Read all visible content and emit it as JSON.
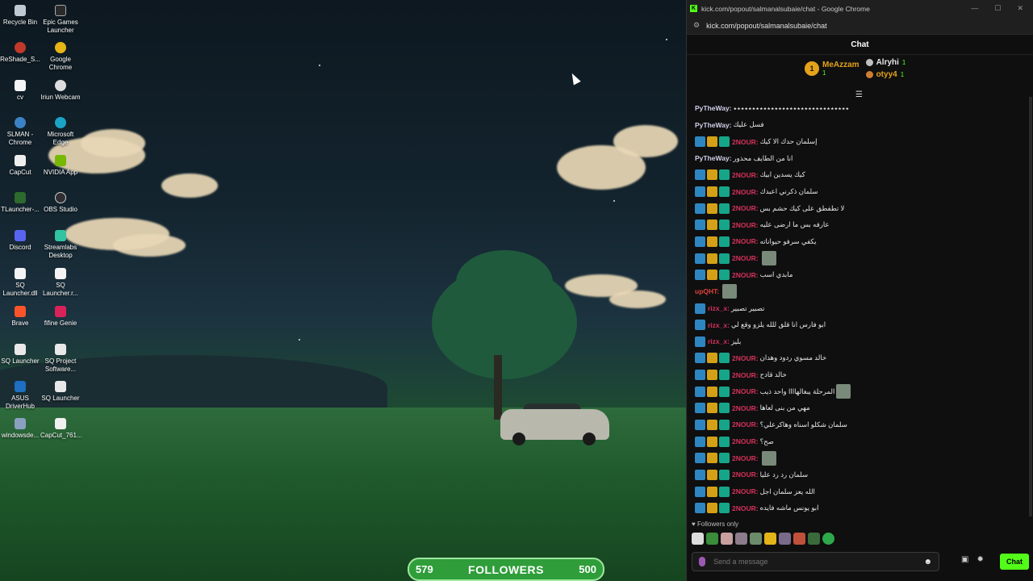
{
  "desktop_icons": [
    {
      "label": "Recycle Bin"
    },
    {
      "label": "Epic Games Launcher"
    },
    {
      "label": "ReShade_S..."
    },
    {
      "label": "Google Chrome"
    },
    {
      "label": "cv"
    },
    {
      "label": "Iriun Webcam"
    },
    {
      "label": "SLMAN - Chrome"
    },
    {
      "label": "Microsoft Edge"
    },
    {
      "label": "CapCut"
    },
    {
      "label": "NVIDIA App"
    },
    {
      "label": "TLauncher-..."
    },
    {
      "label": "OBS Studio"
    },
    {
      "label": "Discord"
    },
    {
      "label": "Streamlabs Desktop"
    },
    {
      "label": "SQ Launcher.dll"
    },
    {
      "label": "SQ Launcher.r..."
    },
    {
      "label": "Brave"
    },
    {
      "label": "fifine Genie"
    },
    {
      "label": "SQ Launcher"
    },
    {
      "label": "SQ Project Software..."
    },
    {
      "label": "ASUS DriverHub"
    },
    {
      "label": "SQ Launcher"
    },
    {
      "label": "windowsde..."
    },
    {
      "label": "CapCut_761..."
    }
  ],
  "followers_bar": {
    "left": "579",
    "label": "FOLLOWERS",
    "right": "500"
  },
  "window": {
    "title": "kick.com/popout/salmanalsubaie/chat - Google Chrome",
    "url": "kick.com/popout/salmanalsubaie/chat",
    "controls": [
      "—",
      "☐",
      "✕"
    ]
  },
  "chat": {
    "header": "Chat",
    "leaderboard": {
      "first": {
        "rank": "1",
        "name": "MeAzzam",
        "count": "1"
      },
      "second": {
        "name": "Alryhi",
        "count": "1"
      },
      "third": {
        "name": "otyy4",
        "count": "1"
      }
    },
    "messages": [
      {
        "user": "PyTheWay:",
        "text": "٭٭٭٭٭٭٭٭٭٭٭٭٭٭٭٭٭٭٭٭٭٭٭٭٭٭٭٭٭٭٭",
        "badges": false,
        "color": "#cfcfe8",
        "emote": false
      },
      {
        "user": "PyTheWay:",
        "text": "فسل عليك",
        "badges": false,
        "color": "#cfcfe8",
        "emote": false
      },
      {
        "user": "2NOUR:",
        "text": "إسلمان حدك الا كيك",
        "badges": true,
        "color": "#d6325a",
        "emote": false
      },
      {
        "user": "PyTheWay:",
        "text": "انا من الطايف محذور",
        "badges": false,
        "color": "#cfcfe8",
        "emote": false
      },
      {
        "user": "2NOUR:",
        "text": "كيك يسدين ابيك",
        "badges": true,
        "color": "#d6325a",
        "emote": false
      },
      {
        "user": "2NOUR:",
        "text": "سلمان ذكرني اعبدك",
        "badges": true,
        "color": "#d6325a",
        "emote": false
      },
      {
        "user": "2NOUR:",
        "text": "لا تطفطق على كيك حشم بس",
        "badges": true,
        "color": "#d6325a",
        "emote": false
      },
      {
        "user": "2NOUR:",
        "text": "عارفه بس ما ارضى عليه",
        "badges": true,
        "color": "#d6325a",
        "emote": false
      },
      {
        "user": "2NOUR:",
        "text": "يكفي سرفو حيواناته",
        "badges": true,
        "color": "#d6325a",
        "emote": false
      },
      {
        "user": "2NOUR:",
        "text": "",
        "badges": true,
        "color": "#d6325a",
        "emote": true
      },
      {
        "user": "2NOUR:",
        "text": "مابدي اسب",
        "badges": true,
        "color": "#d6325a",
        "emote": false
      },
      {
        "user": "upQHT:",
        "text": "",
        "badges": false,
        "color": "#e0433a",
        "emote": true
      },
      {
        "user": "rizx_x:",
        "text": "تصبير تصبير",
        "badges": true,
        "color": "#d6325a",
        "emote": false,
        "single": true
      },
      {
        "user": "rizx_x:",
        "text": "ابو فارس انا قلق للله يلزو وقع لي",
        "badges": true,
        "color": "#d6325a",
        "emote": false,
        "single": true
      },
      {
        "user": "rizx_x:",
        "text": "بليز",
        "badges": true,
        "color": "#d6325a",
        "emote": false,
        "single": true
      },
      {
        "user": "2NOUR:",
        "text": "خالد مسوي ردود وهدان",
        "badges": true,
        "color": "#d6325a",
        "emote": false
      },
      {
        "user": "2NOUR:",
        "text": "خالد قادح",
        "badges": true,
        "color": "#d6325a",
        "emote": false
      },
      {
        "user": "2NOUR:",
        "text": "المرحلة يبغالهاااا واحد ذيب",
        "badges": true,
        "color": "#d6325a",
        "emote": true
      },
      {
        "user": "2NOUR:",
        "text": "مهي من بنى لعاها",
        "badges": true,
        "color": "#d6325a",
        "emote": false
      },
      {
        "user": "2NOUR:",
        "text": "سلمان شكلو اسناه وهاكرعلي؟",
        "badges": true,
        "color": "#d6325a",
        "emote": false
      },
      {
        "user": "2NOUR:",
        "text": "صح؟",
        "badges": true,
        "color": "#d6325a",
        "emote": false
      },
      {
        "user": "2NOUR:",
        "text": "",
        "badges": true,
        "color": "#d6325a",
        "emote": true
      },
      {
        "user": "2NOUR:",
        "text": "سلمان رد رد عليا",
        "badges": true,
        "color": "#d6325a",
        "emote": false
      },
      {
        "user": "2NOUR:",
        "text": "الله يعز سلمان اجل",
        "badges": true,
        "color": "#d6325a",
        "emote": false
      },
      {
        "user": "2NOUR:",
        "text": "ابو يونس ماشه فايده",
        "badges": true,
        "color": "#d6325a",
        "emote": false
      }
    ],
    "followers_only": "Followers only",
    "input_placeholder": "Send a message",
    "send_button": "Chat"
  }
}
